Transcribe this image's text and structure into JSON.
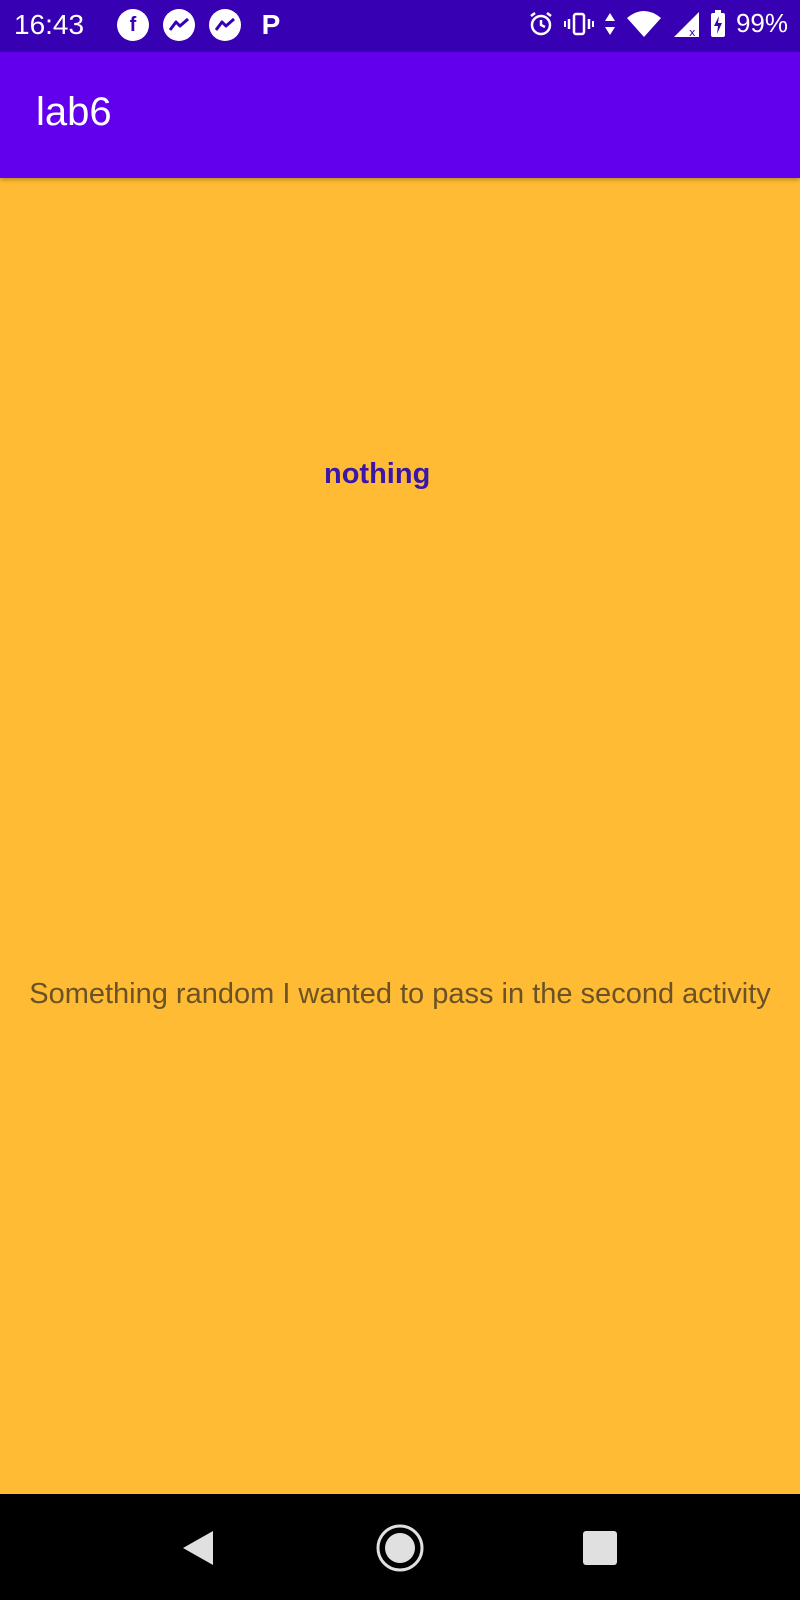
{
  "status_bar": {
    "time": "16:43",
    "battery": "99%",
    "notification_icons": [
      "facebook-icon",
      "messenger-icon",
      "messenger-icon",
      "p-app-icon"
    ],
    "system_icons": [
      "alarm-icon",
      "vibrate-icon",
      "data-arrows-icon",
      "wifi-icon",
      "cell-signal-icon",
      "battery-icon"
    ],
    "p_glyph": "P",
    "facebook_glyph": "f"
  },
  "app_bar": {
    "title": "lab6"
  },
  "content": {
    "label": "nothing",
    "message": "Something random I wanted to pass in the second activity"
  },
  "nav_bar": {
    "buttons": [
      "back-icon",
      "home-icon",
      "recents-icon"
    ]
  },
  "colors": {
    "status_bar": "#3700B3",
    "app_bar": "#6200EE",
    "background": "#FFBB33",
    "label": "#3A17A8",
    "message": "#6B5226",
    "nav_bar": "#000000"
  }
}
